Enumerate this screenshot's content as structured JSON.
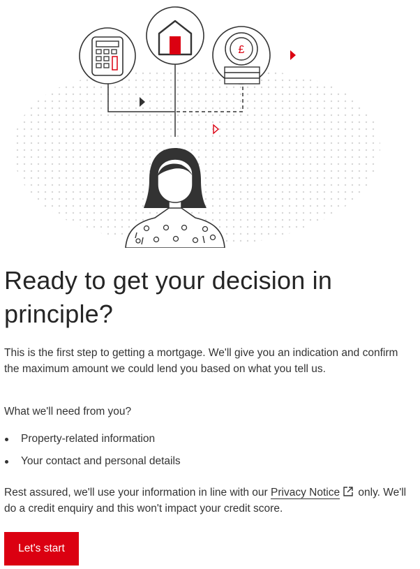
{
  "heading": "Ready to get your decision in principle?",
  "intro": "This is the first step to getting a mortgage. We'll give you an indication and confirm the maximum amount we could lend you based on what you tell us.",
  "needs": {
    "title": "What we'll need from you?",
    "items": [
      "Property-related information",
      "Your contact and personal details"
    ]
  },
  "assurance": {
    "before": "Rest assured, we'll use your information in line with our ",
    "link": "Privacy Notice",
    "after": " only. We'll do a credit enquiry and this won't impact your credit score."
  },
  "cta": {
    "label": "Let's start"
  },
  "hero": {
    "currency_symbol": "£",
    "icons": [
      "calculator-icon",
      "house-icon",
      "pound-coin-icon",
      "woman-avatar",
      "external-link-icon"
    ]
  },
  "colors": {
    "accent": "#db0011",
    "text": "#333333",
    "heading": "#252525",
    "dots": "#d9d9d9"
  }
}
